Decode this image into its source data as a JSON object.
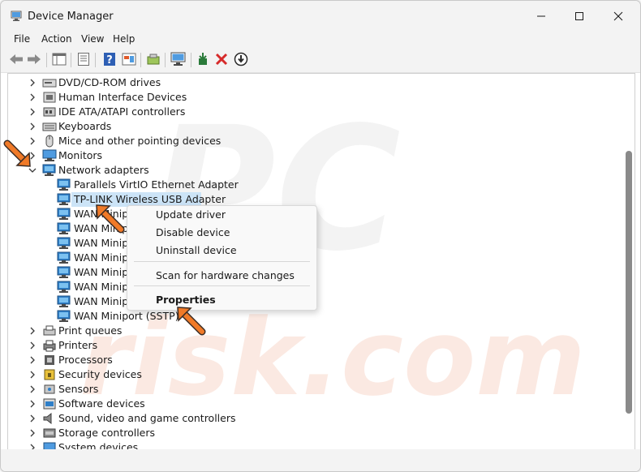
{
  "window": {
    "title": "Device Manager"
  },
  "window_controls": {
    "minimize": "—",
    "maximize": "☐",
    "close": "✕"
  },
  "menu": [
    "File",
    "Action",
    "View",
    "Help"
  ],
  "tree": {
    "categories_before": [
      {
        "label": "DVD/CD-ROM drives",
        "icon": "dvd-drive-icon"
      },
      {
        "label": "Human Interface Devices",
        "icon": "hid-icon"
      },
      {
        "label": "IDE ATA/ATAPI controllers",
        "icon": "ide-controller-icon"
      },
      {
        "label": "Keyboards",
        "icon": "keyboard-icon"
      },
      {
        "label": "Mice and other pointing devices",
        "icon": "mouse-icon"
      },
      {
        "label": "Monitors",
        "icon": "monitor-icon"
      }
    ],
    "network_adapters": {
      "label": "Network adapters",
      "children": [
        "Parallels VirtIO Ethernet Adapter",
        "TP-LINK Wireless USB Adapter",
        "WAN Minipo",
        "WAN Minipo",
        "WAN Minipo",
        "WAN Minipo",
        "WAN Minipo",
        "WAN Minipo",
        "WAN Minipo",
        "WAN Miniport (SSTP)"
      ]
    },
    "categories_after": [
      {
        "label": "Print queues",
        "icon": "print-queue-icon"
      },
      {
        "label": "Printers",
        "icon": "printer-icon"
      },
      {
        "label": "Processors",
        "icon": "processor-icon"
      },
      {
        "label": "Security devices",
        "icon": "security-device-icon"
      },
      {
        "label": "Sensors",
        "icon": "sensor-icon"
      },
      {
        "label": "Software devices",
        "icon": "software-device-icon"
      },
      {
        "label": "Sound, video and game controllers",
        "icon": "sound-icon"
      },
      {
        "label": "Storage controllers",
        "icon": "storage-controller-icon"
      },
      {
        "label": "System devices",
        "icon": "system-device-icon"
      }
    ]
  },
  "context_menu": {
    "update_driver": "Update driver",
    "disable_device": "Disable device",
    "uninstall_device": "Uninstall device",
    "scan_hardware": "Scan for hardware changes",
    "properties": "Properties"
  },
  "colors": {
    "selection": "#cce4f7",
    "arrow": "#f07a28",
    "network_icon": "#2f7fc8"
  }
}
